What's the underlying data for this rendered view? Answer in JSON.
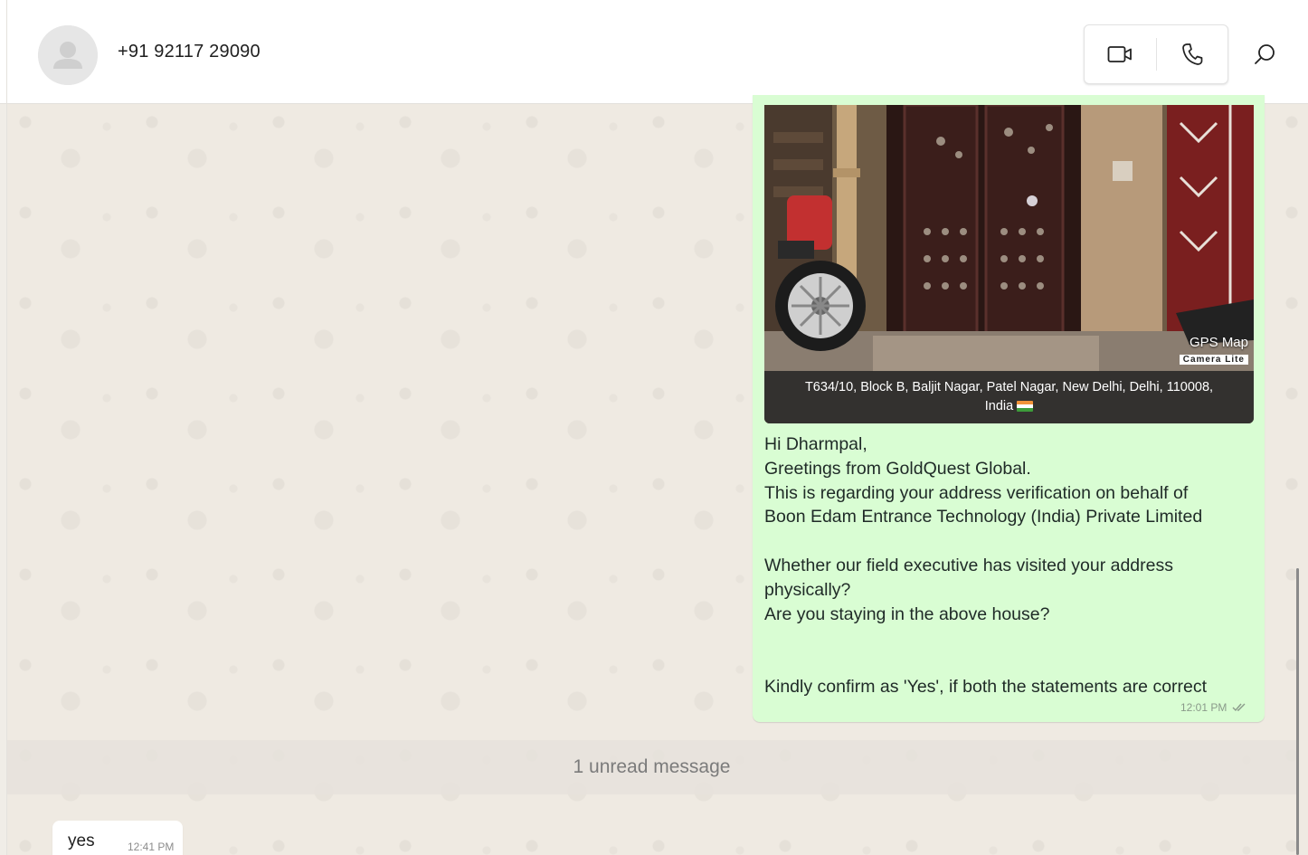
{
  "header": {
    "contact_name": "+91 92117 29090",
    "icons": {
      "avatar": "default-avatar-icon",
      "video_call": "video-camera-icon",
      "voice_call": "phone-icon",
      "search": "search-icon"
    }
  },
  "conversation": {
    "outgoing_message": {
      "photo": {
        "watermark_title": "GPS Map",
        "watermark_subtitle": "Camera Lite",
        "address_line1": "T634/10, Block B, Baljit Nagar, Patel Nagar, New Delhi, Delhi, 110008,",
        "address_line2": "India"
      },
      "lines": [
        "Hi Dharmpal,",
        "Greetings from GoldQuest Global.",
        "This is regarding your address verification on behalf of",
        "Boon Edam Entrance Technology (India) Private Limited",
        "",
        "Whether our field executive has visited your address",
        "physically?",
        "Are you staying in the above house?",
        "",
        "",
        "Kindly confirm as 'Yes', if both the statements are correct"
      ],
      "time": "12:01 PM",
      "status_icon": "double-check-icon"
    },
    "unread_banner": "1 unread message",
    "incoming_message": {
      "text": "yes",
      "time": "12:41 PM"
    }
  },
  "colors": {
    "outgoing_bubble": "#d9fdd3",
    "incoming_bubble": "#ffffff",
    "chat_background": "#efeae2",
    "header_background": "#ffffff"
  }
}
